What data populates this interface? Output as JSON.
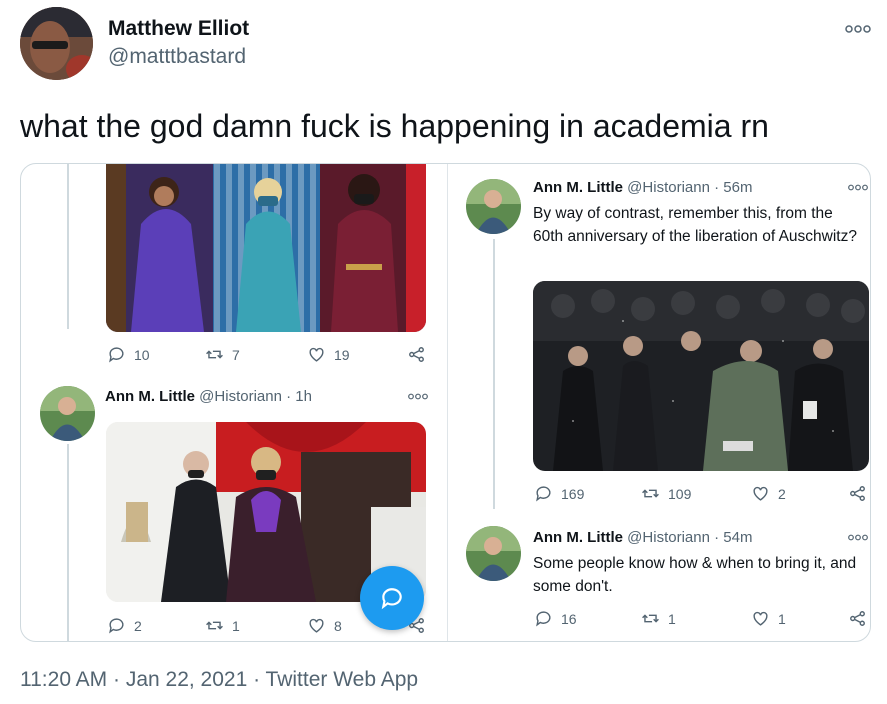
{
  "tweet": {
    "author_name": "Matthew Elliot",
    "author_handle": "@matttbastard",
    "text": "what the god damn fuck is happening in academia rn",
    "timestamp": "11:20 AM · Jan 22, 2021 · Twitter Web App",
    "more_icon": "more-dots-icon"
  },
  "embedded": {
    "left_top_post": {
      "replies": "10",
      "retweets": "7",
      "likes": "19"
    },
    "left_reply": {
      "name": "Ann M. Little",
      "handle": "@Historiann",
      "time": "· 1h",
      "replies": "2",
      "retweets": "1",
      "likes": "8"
    },
    "right_reply_1": {
      "name": "Ann M. Little",
      "handle": "@Historiann",
      "time": "· 56m",
      "body": "By way of contrast, remember this, from the 60th anniversary of the liberation of Auschwitz?",
      "replies": "169",
      "retweets": "109",
      "likes": "2"
    },
    "right_reply_2": {
      "name": "Ann M. Little",
      "handle": "@Historiann",
      "time": "· 54m",
      "body": "Some people know how & when to bring it, and some don't.",
      "replies": "16",
      "retweets": "1",
      "likes": "1"
    }
  },
  "colors": {
    "accent": "#1d9bf0",
    "text_secondary": "#536471",
    "border": "#cfd9de"
  }
}
